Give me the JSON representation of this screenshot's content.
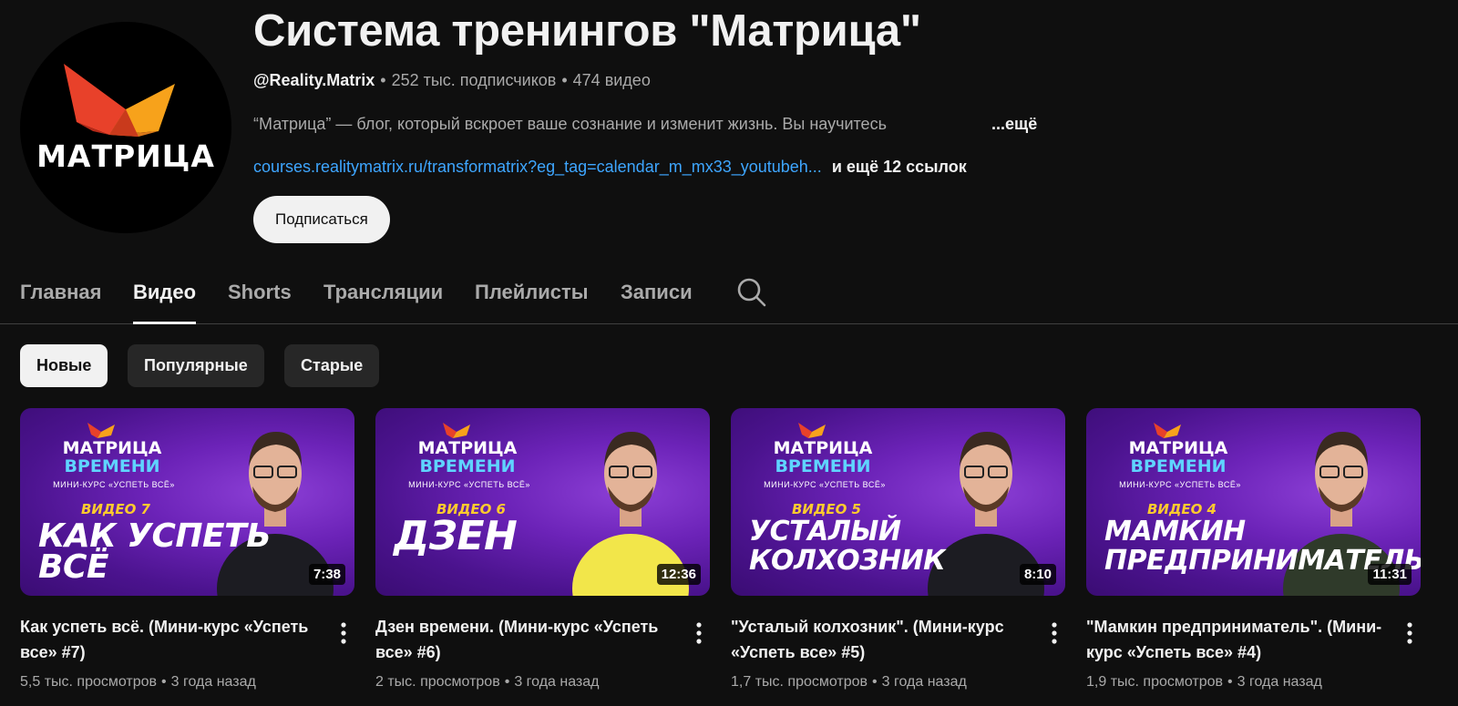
{
  "channel": {
    "title": "Система тренингов \"Матрица\"",
    "avatar_text": "МАТРИЦА",
    "handle": "@Reality.Matrix",
    "subscribers": "252 тыс. подписчиков",
    "videos_count": "474 видео",
    "description": "“Матрица” — блог, который вскроет ваше сознание и изменит жизнь. Вы научитесь",
    "description_more": "...ещё",
    "link": "courses.realitymatrix.ru/transformatrix?eg_tag=calendar_m_mx33_youtubeh...",
    "more_links": "и ещё 12 ссылок",
    "subscribe_label": "Подписаться"
  },
  "tabs": [
    "Главная",
    "Видео",
    "Shorts",
    "Трансляции",
    "Плейлисты",
    "Записи"
  ],
  "active_tab": "Видео",
  "chips": [
    "Новые",
    "Популярные",
    "Старые"
  ],
  "active_chip": "Новые",
  "thumb_common": {
    "brand_line1": "МАТРИЦА",
    "brand_line2": "ВРЕМЕНИ",
    "course": "МИНИ-КУРС «УСПЕТЬ ВСЁ»"
  },
  "videos": [
    {
      "thumb_number": "ВИДЕО 7",
      "thumb_title": "КАК УСПЕТЬ ВСЁ",
      "duration": "7:38",
      "title": "Как успеть всё. (Мини-курс «Успеть все» #7)",
      "views": "5,5 тыс. просмотров",
      "age": "3 года назад"
    },
    {
      "thumb_number": "ВИДЕО 6",
      "thumb_title": "ДЗЕН",
      "duration": "12:36",
      "title": "Дзен времени. (Мини-курс «Успеть все» #6)",
      "views": "2 тыс. просмотров",
      "age": "3 года назад"
    },
    {
      "thumb_number": "ВИДЕО 5",
      "thumb_title": "УСТАЛЫЙ КОЛХОЗНИК",
      "duration": "8:10",
      "title": "\"Усталый колхозник\". (Мини-курс «Успеть все» #5)",
      "views": "1,7 тыс. просмотров",
      "age": "3 года назад"
    },
    {
      "thumb_number": "ВИДЕО 4",
      "thumb_title": "МАМКИН ПРЕДПРИНИМАТЕЛЬ",
      "duration": "11:31",
      "title": "\"Мамкин предприниматель\". (Мини-курс «Успеть все» #4)",
      "views": "1,9 тыс. просмотров",
      "age": "3 года назад"
    }
  ],
  "colors": {
    "background": "#0f0f0f",
    "link": "#3ea6ff",
    "thumb_purple": "#6c23b8",
    "logo_red": "#e8412a",
    "logo_orange": "#f7a21b"
  },
  "icons": {
    "search": "search-icon",
    "more": "more-vert-icon"
  }
}
